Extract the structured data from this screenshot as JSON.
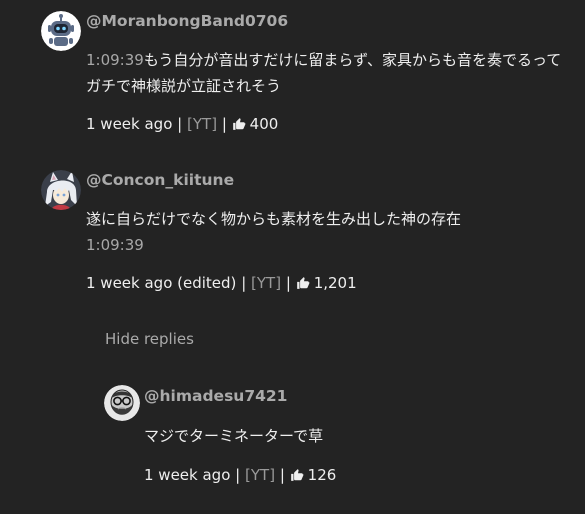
{
  "comments": [
    {
      "author": "@MoranbongBand0706",
      "timestamp": "1:09:39",
      "text": "もう自分が音出すだけに留まらず、家具からも音を奏でるってガチで神様説が立証されそう",
      "age": "1 week ago",
      "source_link": "[YT]",
      "likes": "400",
      "avatar_icon": "robot-avatar-icon"
    },
    {
      "author": "@Concon_kiitune",
      "text": "遂に自らだけでなく物からも素材を生み出した神の存在",
      "timestamp": "1:09:39",
      "age": "1 week ago (edited)",
      "source_link": "[YT]",
      "likes": "1,201",
      "avatar_icon": "anime-girl-avatar-icon"
    }
  ],
  "hide_replies_label": "Hide replies",
  "reply": {
    "author": "@himadesu7421",
    "text": "マジでターミネーターで草",
    "age": "1 week ago",
    "source_link": "[YT]",
    "likes": "126",
    "avatar_icon": "bearded-man-avatar-icon"
  },
  "separator": "|",
  "like_icon": "thumbs-up-icon",
  "colors": {
    "background": "#232323",
    "author": "#aaaaaa",
    "timestamp": "#a8a8a8",
    "link": "#9a9a9a",
    "text": "#eeeeee"
  }
}
